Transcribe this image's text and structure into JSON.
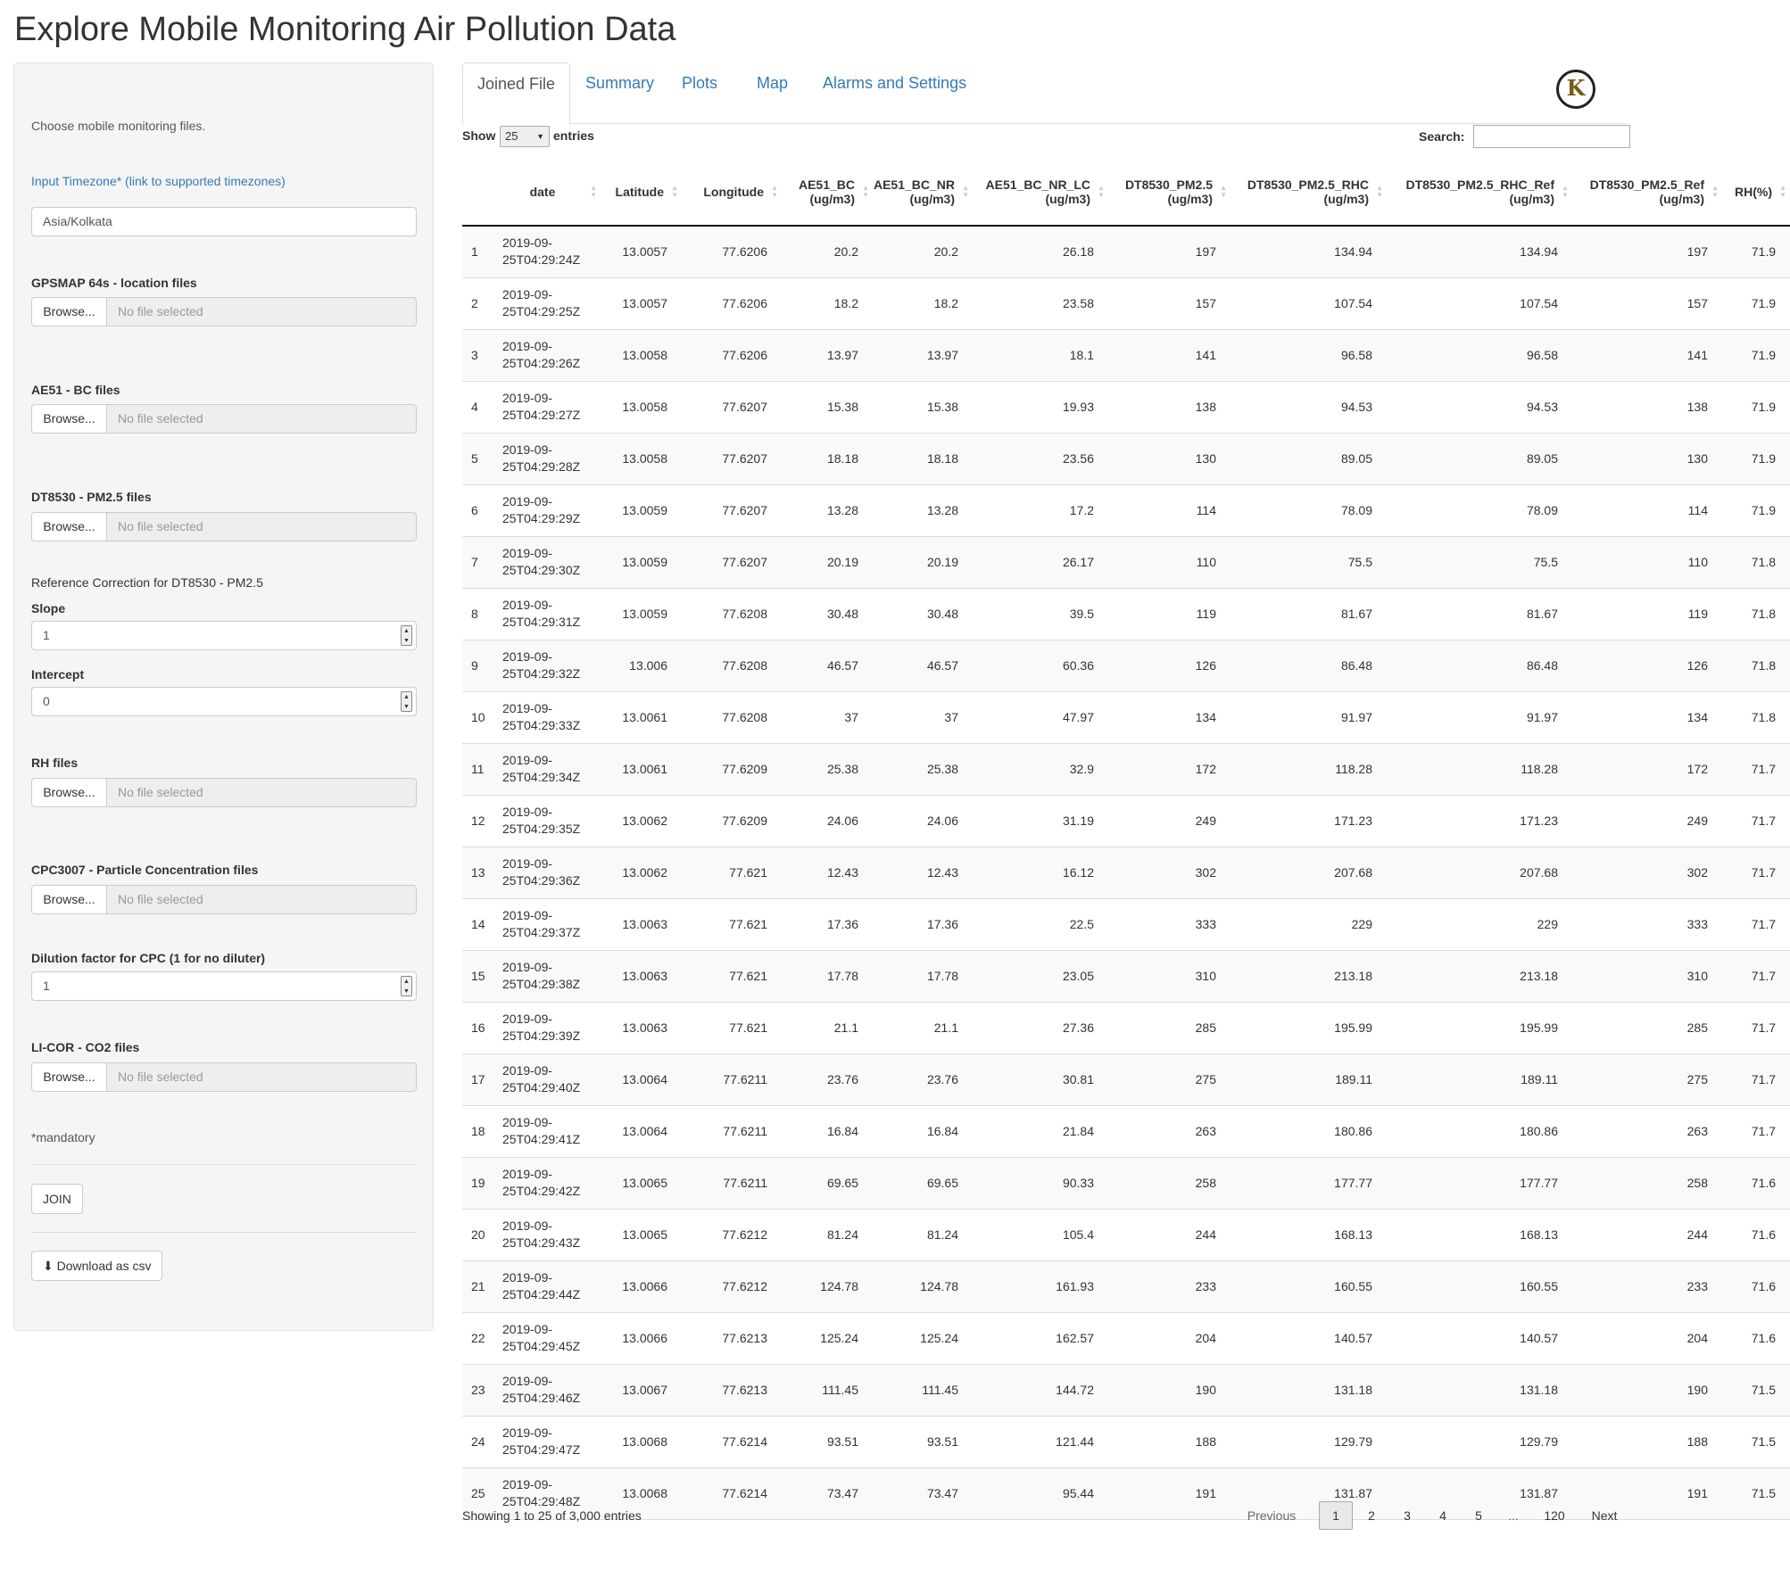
{
  "title": "Explore Mobile Monitoring Air Pollution Data",
  "sidebar": {
    "intro": "Choose mobile monitoring files.",
    "timezone_link": "Input Timezone* (link to supported timezones)",
    "timezone_value": "Asia/Kolkata",
    "browse_label": "Browse...",
    "no_file": "No file selected",
    "gps_label": "GPSMAP 64s - location files",
    "ae51_label": "AE51 - BC files",
    "dt8530_label": "DT8530 - PM2.5 files",
    "ref_correction": "Reference Correction for DT8530 - PM2.5",
    "slope_label": "Slope",
    "slope_value": "1",
    "intercept_label": "Intercept",
    "intercept_value": "0",
    "rh_label": "RH files",
    "cpc_label": "CPC3007 - Particle Concentration files",
    "dilution_label": "Dilution factor for CPC (1 for no diluter)",
    "dilution_value": "1",
    "licor_label": "LI-COR - CO2 files",
    "mandatory": "*mandatory",
    "join_label": "JOIN",
    "download_label": "Download as csv"
  },
  "tabs": [
    "Joined File",
    "Summary",
    "Plots",
    "Map",
    "Alarms and Settings"
  ],
  "logo_letter": "K",
  "controls": {
    "show": "Show",
    "entries_count": "25",
    "entries": "entries",
    "search_label": "Search:",
    "search_value": ""
  },
  "table": {
    "columns": [
      [
        "",
        ""
      ],
      [
        "date",
        ""
      ],
      [
        "Latitude",
        ""
      ],
      [
        "Longitude",
        ""
      ],
      [
        "AE51_BC",
        "(ug/m3)"
      ],
      [
        "AE51_BC_NR",
        "(ug/m3)"
      ],
      [
        "AE51_BC_NR_LC",
        "(ug/m3)"
      ],
      [
        "DT8530_PM2.5",
        "(ug/m3)"
      ],
      [
        "DT8530_PM2.5_RHC",
        "(ug/m3)"
      ],
      [
        "DT8530_PM2.5_RHC_Ref",
        "(ug/m3)"
      ],
      [
        "DT8530_PM2.5_Ref",
        "(ug/m3)"
      ],
      [
        "RH(%)",
        ""
      ]
    ],
    "rows": [
      [
        "1",
        "2019-09-",
        "25T04:29:24Z",
        "13.0057",
        "77.6206",
        "20.2",
        "20.2",
        "26.18",
        "197",
        "134.94",
        "134.94",
        "197",
        "71.9"
      ],
      [
        "2",
        "2019-09-",
        "25T04:29:25Z",
        "13.0057",
        "77.6206",
        "18.2",
        "18.2",
        "23.58",
        "157",
        "107.54",
        "107.54",
        "157",
        "71.9"
      ],
      [
        "3",
        "2019-09-",
        "25T04:29:26Z",
        "13.0058",
        "77.6206",
        "13.97",
        "13.97",
        "18.1",
        "141",
        "96.58",
        "96.58",
        "141",
        "71.9"
      ],
      [
        "4",
        "2019-09-",
        "25T04:29:27Z",
        "13.0058",
        "77.6207",
        "15.38",
        "15.38",
        "19.93",
        "138",
        "94.53",
        "94.53",
        "138",
        "71.9"
      ],
      [
        "5",
        "2019-09-",
        "25T04:29:28Z",
        "13.0058",
        "77.6207",
        "18.18",
        "18.18",
        "23.56",
        "130",
        "89.05",
        "89.05",
        "130",
        "71.9"
      ],
      [
        "6",
        "2019-09-",
        "25T04:29:29Z",
        "13.0059",
        "77.6207",
        "13.28",
        "13.28",
        "17.2",
        "114",
        "78.09",
        "78.09",
        "114",
        "71.9"
      ],
      [
        "7",
        "2019-09-",
        "25T04:29:30Z",
        "13.0059",
        "77.6207",
        "20.19",
        "20.19",
        "26.17",
        "110",
        "75.5",
        "75.5",
        "110",
        "71.8"
      ],
      [
        "8",
        "2019-09-",
        "25T04:29:31Z",
        "13.0059",
        "77.6208",
        "30.48",
        "30.48",
        "39.5",
        "119",
        "81.67",
        "81.67",
        "119",
        "71.8"
      ],
      [
        "9",
        "2019-09-",
        "25T04:29:32Z",
        "13.006",
        "77.6208",
        "46.57",
        "46.57",
        "60.36",
        "126",
        "86.48",
        "86.48",
        "126",
        "71.8"
      ],
      [
        "10",
        "2019-09-",
        "25T04:29:33Z",
        "13.0061",
        "77.6208",
        "37",
        "37",
        "47.97",
        "134",
        "91.97",
        "91.97",
        "134",
        "71.8"
      ],
      [
        "11",
        "2019-09-",
        "25T04:29:34Z",
        "13.0061",
        "77.6209",
        "25.38",
        "25.38",
        "32.9",
        "172",
        "118.28",
        "118.28",
        "172",
        "71.7"
      ],
      [
        "12",
        "2019-09-",
        "25T04:29:35Z",
        "13.0062",
        "77.6209",
        "24.06",
        "24.06",
        "31.19",
        "249",
        "171.23",
        "171.23",
        "249",
        "71.7"
      ],
      [
        "13",
        "2019-09-",
        "25T04:29:36Z",
        "13.0062",
        "77.621",
        "12.43",
        "12.43",
        "16.12",
        "302",
        "207.68",
        "207.68",
        "302",
        "71.7"
      ],
      [
        "14",
        "2019-09-",
        "25T04:29:37Z",
        "13.0063",
        "77.621",
        "17.36",
        "17.36",
        "22.5",
        "333",
        "229",
        "229",
        "333",
        "71.7"
      ],
      [
        "15",
        "2019-09-",
        "25T04:29:38Z",
        "13.0063",
        "77.621",
        "17.78",
        "17.78",
        "23.05",
        "310",
        "213.18",
        "213.18",
        "310",
        "71.7"
      ],
      [
        "16",
        "2019-09-",
        "25T04:29:39Z",
        "13.0063",
        "77.621",
        "21.1",
        "21.1",
        "27.36",
        "285",
        "195.99",
        "195.99",
        "285",
        "71.7"
      ],
      [
        "17",
        "2019-09-",
        "25T04:29:40Z",
        "13.0064",
        "77.6211",
        "23.76",
        "23.76",
        "30.81",
        "275",
        "189.11",
        "189.11",
        "275",
        "71.7"
      ],
      [
        "18",
        "2019-09-",
        "25T04:29:41Z",
        "13.0064",
        "77.6211",
        "16.84",
        "16.84",
        "21.84",
        "263",
        "180.86",
        "180.86",
        "263",
        "71.7"
      ],
      [
        "19",
        "2019-09-",
        "25T04:29:42Z",
        "13.0065",
        "77.6211",
        "69.65",
        "69.65",
        "90.33",
        "258",
        "177.77",
        "177.77",
        "258",
        "71.6"
      ],
      [
        "20",
        "2019-09-",
        "25T04:29:43Z",
        "13.0065",
        "77.6212",
        "81.24",
        "81.24",
        "105.4",
        "244",
        "168.13",
        "168.13",
        "244",
        "71.6"
      ],
      [
        "21",
        "2019-09-",
        "25T04:29:44Z",
        "13.0066",
        "77.6212",
        "124.78",
        "124.78",
        "161.93",
        "233",
        "160.55",
        "160.55",
        "233",
        "71.6"
      ],
      [
        "22",
        "2019-09-",
        "25T04:29:45Z",
        "13.0066",
        "77.6213",
        "125.24",
        "125.24",
        "162.57",
        "204",
        "140.57",
        "140.57",
        "204",
        "71.6"
      ],
      [
        "23",
        "2019-09-",
        "25T04:29:46Z",
        "13.0067",
        "77.6213",
        "111.45",
        "111.45",
        "144.72",
        "190",
        "131.18",
        "131.18",
        "190",
        "71.5"
      ],
      [
        "24",
        "2019-09-",
        "25T04:29:47Z",
        "13.0068",
        "77.6214",
        "93.51",
        "93.51",
        "121.44",
        "188",
        "129.79",
        "129.79",
        "188",
        "71.5"
      ],
      [
        "25",
        "2019-09-",
        "25T04:29:48Z",
        "13.0068",
        "77.6214",
        "73.47",
        "73.47",
        "95.44",
        "191",
        "131.87",
        "131.87",
        "191",
        "71.5"
      ]
    ]
  },
  "footer": {
    "info": "Showing 1 to 25 of 3,000 entries",
    "pages": [
      "Previous",
      "1",
      "2",
      "3",
      "4",
      "5",
      "...",
      "120",
      "Next"
    ]
  }
}
